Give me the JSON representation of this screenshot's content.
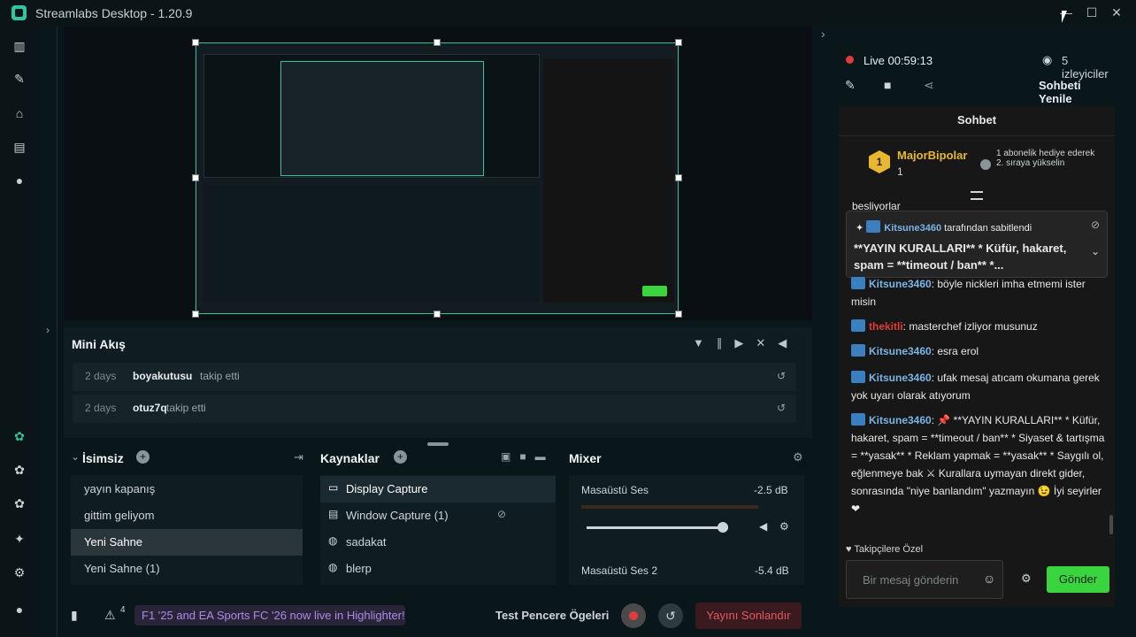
{
  "app": {
    "title": "Streamlabs Desktop - 1.20.9"
  },
  "colors": {
    "accent": "#31c3a2",
    "live": "#e03c3c",
    "send": "#3ad43f",
    "username": "#7bb5e6",
    "donor": "#e8b830"
  },
  "stream_status": {
    "live_label": "Live",
    "duration": "00:59:13",
    "viewers": "5 izleyiciler",
    "refresh_chat": "Sohbeti Yenile"
  },
  "mini_feed": {
    "title": "Mini Akış",
    "events": [
      {
        "time": "2 days",
        "user": "boyakutusu",
        "action": "takip etti"
      },
      {
        "time": "2 days",
        "user": "otuz7q",
        "action": "takip etti"
      }
    ]
  },
  "scenes": {
    "title": "İsimsiz",
    "items": [
      "yayın kapanış",
      "gittim geliyom",
      "Yeni Sahne",
      "Yeni Sahne (1)"
    ],
    "selected_index": 2
  },
  "sources": {
    "title": "Kaynaklar",
    "items": [
      "Display Capture",
      "Window Capture (1)",
      "sadakat",
      "blerp"
    ],
    "selected_index": 0
  },
  "mixer": {
    "title": "Mixer",
    "channels": [
      {
        "name": "Masaüstü Ses",
        "level": "-2.5 dB",
        "volume": 0.96
      },
      {
        "name": "Masaüstü Ses 2",
        "level": "-5.4 dB"
      }
    ]
  },
  "status_bar": {
    "alert_count": "4",
    "promo": "F1 '25 and EA Sports FC '26 now live in Highlighter!",
    "test_widgets": "Test Pencere Ögeleri",
    "end_stream": "Yayını Sonlandır"
  },
  "chat": {
    "title": "Sohbet",
    "donor": {
      "name": "MajorBipolar",
      "rank": "1",
      "count": "1",
      "note": "1 abonelik hediye ederek 2. sıraya yükselin"
    },
    "cut_text": "besliyorlar",
    "pinned": {
      "by": "Kitsune3460",
      "by_suffix": "tarafından sabitlendi",
      "text": "**YAYIN KURALLARI** * Küfür, hakaret, spam = **timeout / ban** *..."
    },
    "messages": [
      {
        "user": "Kitsune3460",
        "text": "böyle nickleri imha etmemi ister misin",
        "user_color": "#7bb5e6"
      },
      {
        "user": "thekitli",
        "text": "masterchef izliyor musunuz",
        "user_color": "#e03c3c"
      },
      {
        "user": "Kitsune3460",
        "text": "esra erol",
        "user_color": "#7bb5e6"
      },
      {
        "user": "Kitsune3460",
        "text": "ufak mesaj atıcam okumana gerek yok uyarı olarak atıyorum",
        "user_color": "#7bb5e6"
      },
      {
        "user": "Kitsune3460",
        "text": "📌 **YAYIN KURALLARI** * Küfür, hakaret, spam = **timeout / ban** * Siyaset & tartışma = **yasak** * Reklam yapmak = **yasak** * Saygılı ol, eğlenmeye bak ⚔ Kurallara uymayan direkt gider, sonrasında \"niye banlandım\" yazmayın 😉 İyi seyirler ❤",
        "user_color": "#7bb5e6"
      }
    ],
    "followers_only": "Takipçilere Özel",
    "input_placeholder": "Bir mesaj gönderin",
    "send_label": "Gönder"
  }
}
